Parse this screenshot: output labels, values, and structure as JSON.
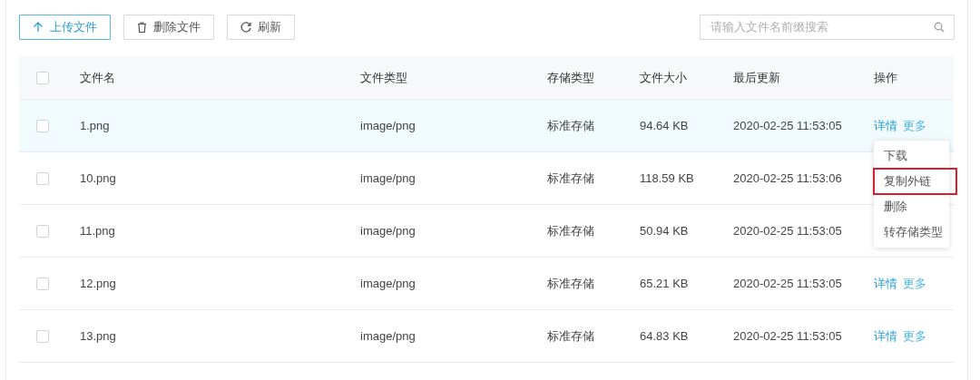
{
  "toolbar": {
    "buttons": [
      {
        "kind": "upload",
        "label": "上传文件",
        "primary": true
      },
      {
        "kind": "delete",
        "label": "删除文件",
        "primary": false
      },
      {
        "kind": "refresh",
        "label": "刷新",
        "primary": false
      }
    ],
    "search": {
      "placeholder": "请输入文件名前缀搜索"
    }
  },
  "table": {
    "select_all": {
      "checked": false
    },
    "columns": [
      "文件名",
      "文件类型",
      "存储类型",
      "文件大小",
      "最后更新",
      "操作"
    ],
    "rows": [
      {
        "checked": false,
        "hovered": true,
        "cells": [
          "1.png",
          "image/png",
          "标准存储",
          "94.64 KB",
          "2020-02-25 11:53:05"
        ],
        "actions": [
          "详情",
          "更多"
        ]
      },
      {
        "checked": false,
        "hovered": false,
        "cells": [
          "10.png",
          "image/png",
          "标准存储",
          "118.59 KB",
          "2020-02-25 11:53:06"
        ]
      },
      {
        "checked": false,
        "hovered": false,
        "cells": [
          "11.png",
          "image/png",
          "标准存储",
          "50.94 KB",
          "2020-02-25 11:53:05"
        ]
      },
      {
        "checked": false,
        "hovered": false,
        "cells": [
          "12.png",
          "image/png",
          "标准存储",
          "65.21 KB",
          "2020-02-25 11:53:05"
        ],
        "actions": [
          "详情",
          "更多"
        ]
      },
      {
        "checked": false,
        "hovered": false,
        "cells": [
          "13.png",
          "image/png",
          "标准存储",
          "64.83 KB",
          "2020-02-25 11:53:05"
        ],
        "actions": [
          "详情",
          "更多"
        ]
      }
    ]
  },
  "more_menu": {
    "items": [
      {
        "label": "下载",
        "highlighted": false
      },
      {
        "label": "复制外链",
        "highlighted": true
      },
      {
        "label": "删除",
        "highlighted": false
      },
      {
        "label": "转存储类型",
        "highlighted": false
      }
    ]
  }
}
